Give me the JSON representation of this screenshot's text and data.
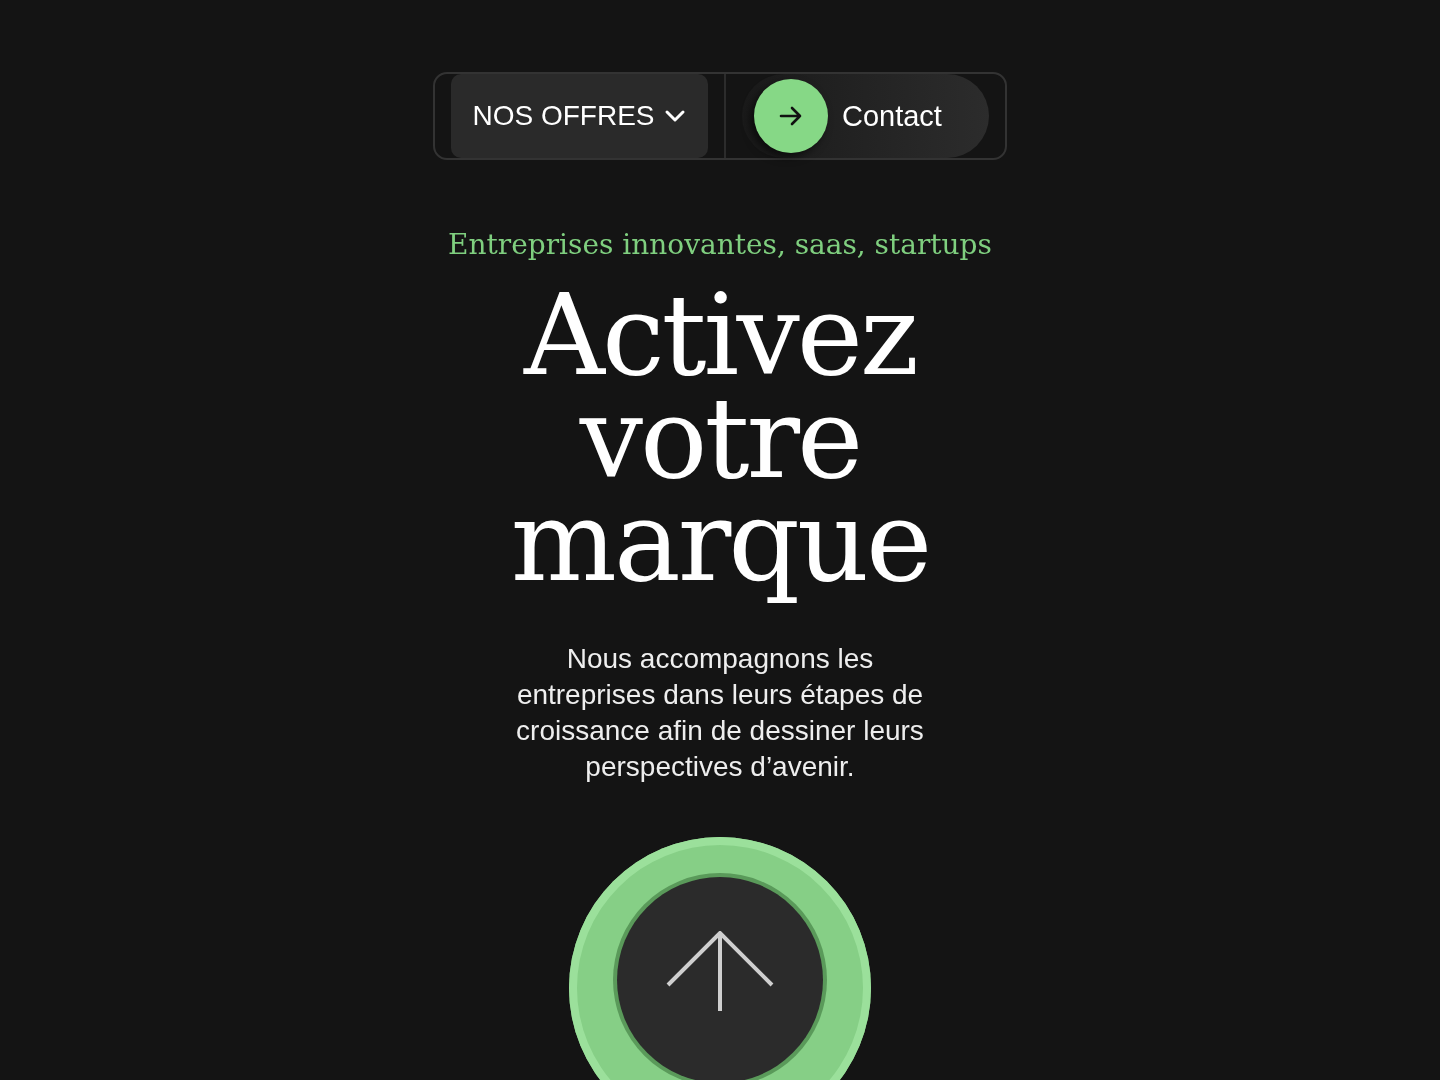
{
  "nav": {
    "offers_button": {
      "label": "NOS OFFRES",
      "expanded": false
    },
    "contact_button": {
      "label": "Contact"
    }
  },
  "hero": {
    "tagline": "Entreprises innovantes, saas, startups",
    "headline": [
      "Activez",
      "votre",
      "marque"
    ],
    "description": "Nous accompagnons les entreprises dans leurs étapes de croissance afin de dessiner leurs perspectives d’avenir."
  }
}
